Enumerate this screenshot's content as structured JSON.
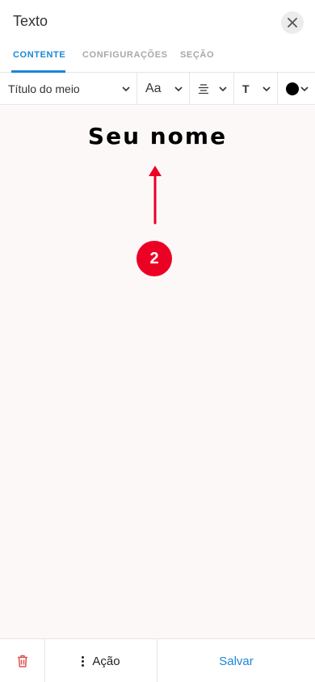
{
  "header": {
    "title": "Texto",
    "close_icon": "close-icon"
  },
  "tabs": [
    {
      "label": "CONTENTE",
      "active": true
    },
    {
      "label": "CONFIGURAÇÕES",
      "active": false
    },
    {
      "label": "SEÇÃO",
      "active": false
    }
  ],
  "toolbar": {
    "text_style": "Título do meio",
    "text_case": "Aa",
    "align_icon": "align-center-icon",
    "type_label": "T",
    "color": "#000000"
  },
  "canvas": {
    "heading": "Seu nome",
    "annotation": {
      "step_number": "2",
      "arrow_icon": "arrow-up-icon",
      "color": "#ec0024"
    }
  },
  "bottom_bar": {
    "delete_icon": "trash-icon",
    "action_label": "Ação",
    "save_label": "Salvar"
  },
  "colors": {
    "accent": "#1a87d6",
    "danger": "#d9534f",
    "canvas_bg": "#fcf8f8"
  }
}
